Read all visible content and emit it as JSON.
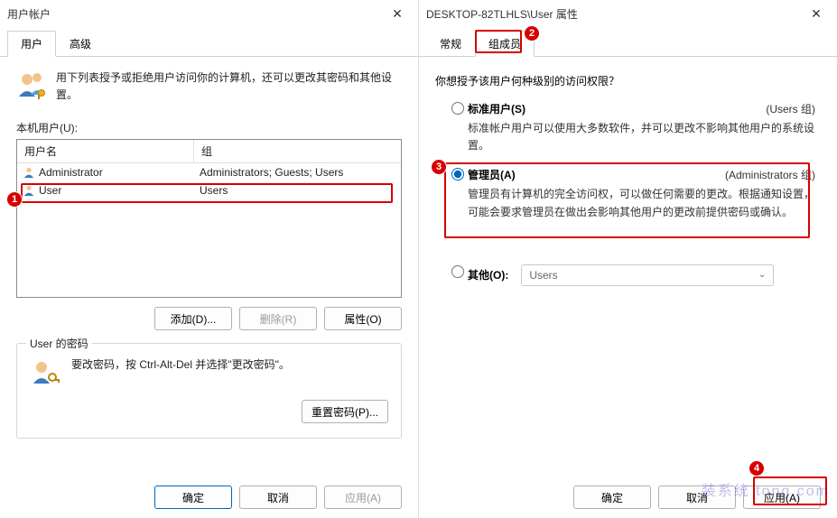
{
  "left": {
    "title": "用户帐户",
    "tabs": {
      "users": "用户",
      "advanced": "高级"
    },
    "instruction": "用下列表授予或拒绝用户访问你的计算机，还可以更改其密码和其他设置。",
    "list_label": "本机用户(U):",
    "columns": {
      "name": "用户名",
      "group": "组"
    },
    "rows": [
      {
        "name": "Administrator",
        "group": "Administrators; Guests; Users"
      },
      {
        "name": "User",
        "group": "Users"
      }
    ],
    "buttons": {
      "add": "添加(D)...",
      "remove": "删除(R)",
      "properties": "属性(O)"
    },
    "password_group": {
      "legend": "User 的密码",
      "text": "要改密码，按 Ctrl-Alt-Del 并选择\"更改密码\"。",
      "reset": "重置密码(P)..."
    },
    "dlg_buttons": {
      "ok": "确定",
      "cancel": "取消",
      "apply": "应用(A)"
    }
  },
  "right": {
    "title": "DESKTOP-82TLHLS\\User 属性",
    "tabs": {
      "general": "常规",
      "membership": "组成员"
    },
    "question": "你想授予该用户何种级别的访问权限？",
    "options": {
      "standard": {
        "label": "标准用户(S)",
        "hint": "(Users 组)",
        "desc": "标准帐户用户可以使用大多数软件，并可以更改不影响其他用户的系统设置。"
      },
      "admin": {
        "label": "管理员(A)",
        "hint": "(Administrators 组)",
        "desc": "管理员有计算机的完全访问权，可以做任何需要的更改。根据通知设置，可能会要求管理员在做出会影响其他用户的更改前提供密码或确认。"
      },
      "other": {
        "label": "其他(O):",
        "select_value": "Users"
      }
    },
    "dlg_buttons": {
      "ok": "确定",
      "cancel": "取消",
      "apply": "应用(A)"
    }
  },
  "annotations": {
    "badge1": "1",
    "badge2": "2",
    "badge3": "3",
    "badge4": "4"
  },
  "watermark": "装系统 tong.com"
}
